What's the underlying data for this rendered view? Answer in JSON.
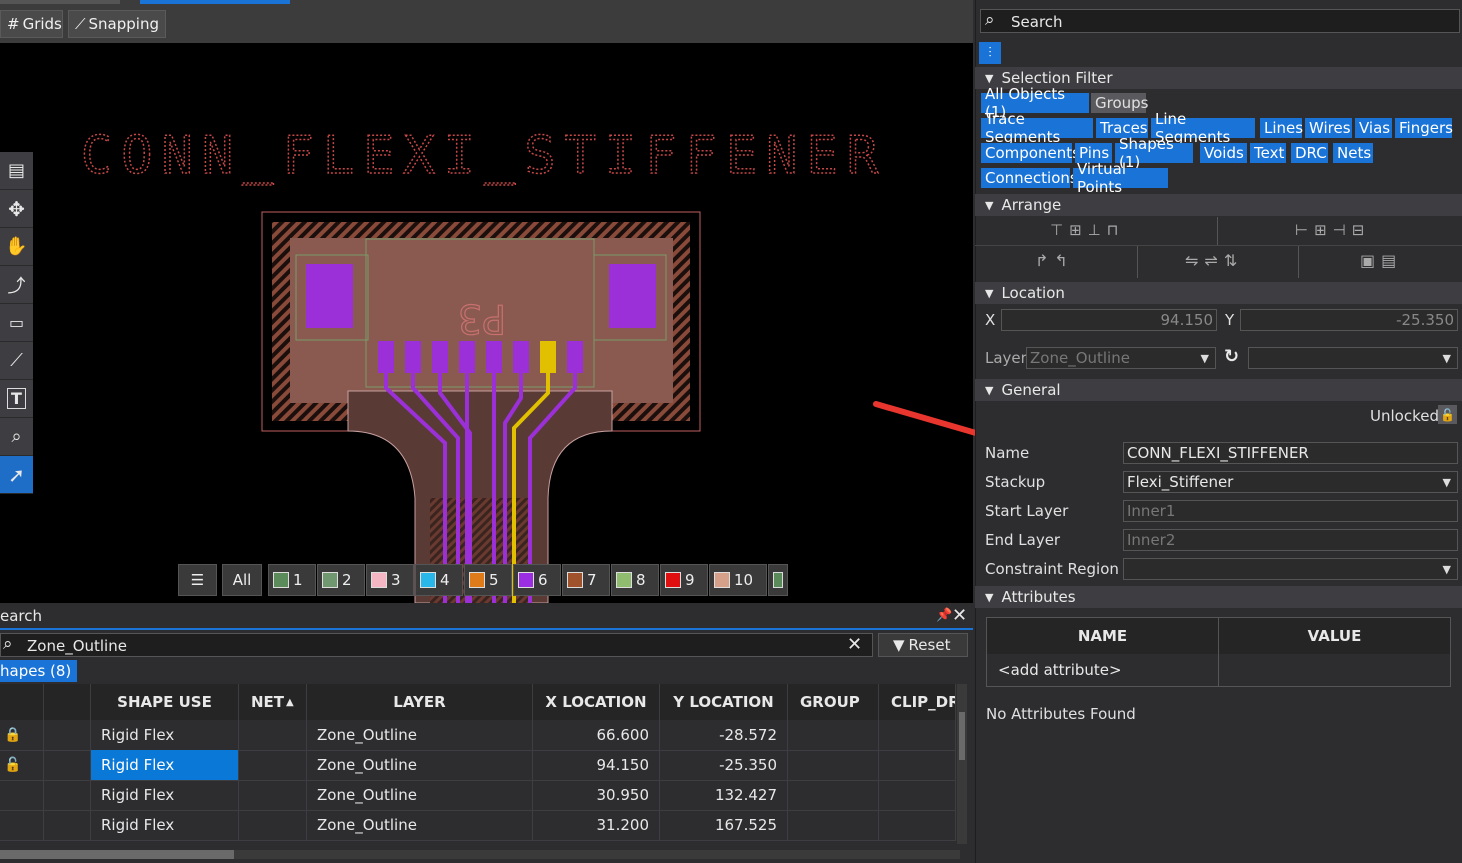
{
  "toolbar": {
    "grids_label": "Grids",
    "snapping_label": "Snapping"
  },
  "canvas": {
    "board_title": "CONN_FLEXI_STIFFENER",
    "ref_designator": "P3"
  },
  "layers": {
    "all_label": "All",
    "items": [
      {
        "label": "1",
        "color": "#5b8a5b"
      },
      {
        "label": "2",
        "color": "#6f9870"
      },
      {
        "label": "3",
        "color": "#f4b6c2"
      },
      {
        "label": "4",
        "color": "#29b6e8"
      },
      {
        "label": "5",
        "color": "#e07b1a"
      },
      {
        "label": "6",
        "color": "#9a2ee0"
      },
      {
        "label": "7",
        "color": "#a0522d"
      },
      {
        "label": "8",
        "color": "#8fbc6f"
      },
      {
        "label": "9",
        "color": "#e01010"
      },
      {
        "label": "10",
        "color": "#d4a08a"
      }
    ]
  },
  "search": {
    "panel_title": "earch",
    "query": "Zone_Outline",
    "reset_label": "Reset",
    "results_tab": "hapes (8)",
    "columns": [
      "SHAPE USE",
      "NET",
      "LAYER",
      "X LOCATION",
      "Y LOCATION",
      "GROUP",
      "CLIP_DRA"
    ],
    "rows": [
      {
        "locked": "locked",
        "shape_use": "Rigid Flex",
        "layer": "Zone_Outline",
        "x": "66.600",
        "y": "-28.572"
      },
      {
        "locked": "unlocked",
        "shape_use": "Rigid Flex",
        "layer": "Zone_Outline",
        "x": "94.150",
        "y": "-25.350"
      },
      {
        "locked": "",
        "shape_use": "Rigid Flex",
        "layer": "Zone_Outline",
        "x": "30.950",
        "y": "132.427"
      },
      {
        "locked": "",
        "shape_use": "Rigid Flex",
        "layer": "Zone_Outline",
        "x": "31.200",
        "y": "167.525"
      }
    ]
  },
  "right": {
    "search_placeholder": "Search",
    "selection_filter": {
      "title": "Selection Filter",
      "chips": [
        "All Objects (1)",
        "Groups",
        "Trace Segments",
        "Traces",
        "Line Segments",
        "Lines",
        "Wires",
        "Vias",
        "Fingers",
        "Components",
        "Pins",
        "Shapes (1)",
        "Voids",
        "Text",
        "DRC",
        "Nets",
        "Connections",
        "Virtual Points"
      ]
    },
    "arrange_title": "Arrange",
    "location": {
      "title": "Location",
      "x_label": "X",
      "x_value": "94.150",
      "y_label": "Y",
      "y_value": "-25.350",
      "layer_label": "Layer",
      "layer_value": "Zone_Outline"
    },
    "general": {
      "title": "General",
      "lock_state": "Unlocked",
      "name_label": "Name",
      "name_value": "CONN_FLEXI_STIFFENER",
      "stackup_label": "Stackup",
      "stackup_value": "Flexi_Stiffener",
      "start_layer_label": "Start Layer",
      "start_layer_value": "Inner1",
      "end_layer_label": "End Layer",
      "end_layer_value": "Inner2",
      "constraint_label": "Constraint Region",
      "constraint_value": ""
    },
    "attributes": {
      "title": "Attributes",
      "col_name": "NAME",
      "col_value": "VALUE",
      "add_row": "<add attribute>",
      "empty_text": "No Attributes Found"
    }
  },
  "colors": {
    "accent": "#1a73d6",
    "arrow": "#e8362e",
    "selected_cell": "#0a78d7"
  }
}
